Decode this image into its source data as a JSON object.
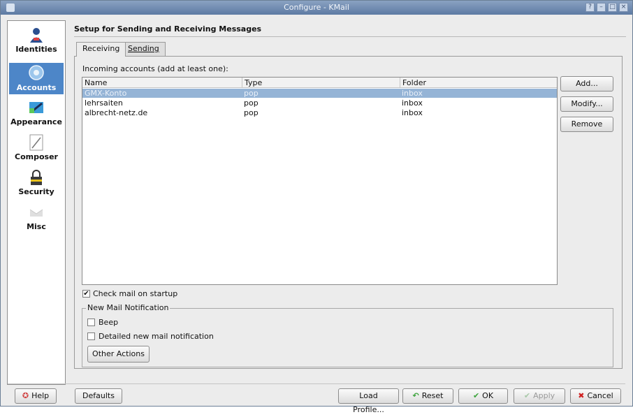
{
  "window": {
    "title": "Configure - KMail"
  },
  "sidebar": {
    "items": [
      {
        "label": "Identities",
        "icon": "identities-icon"
      },
      {
        "label": "Accounts",
        "icon": "accounts-icon"
      },
      {
        "label": "Appearance",
        "icon": "appearance-icon"
      },
      {
        "label": "Composer",
        "icon": "composer-icon"
      },
      {
        "label": "Security",
        "icon": "security-icon"
      },
      {
        "label": "Misc",
        "icon": "misc-icon"
      }
    ],
    "selected": "Accounts"
  },
  "header": {
    "title": "Setup for Sending and Receiving Messages"
  },
  "tabs": [
    {
      "label": "Receiving",
      "active": true
    },
    {
      "label": "Sending",
      "active": false
    }
  ],
  "receiving": {
    "accounts_label": "Incoming accounts (add at least one):",
    "columns": [
      "Name",
      "Type",
      "Folder"
    ],
    "rows": [
      {
        "name": "GMX-Konto",
        "type": "pop",
        "folder": "inbox",
        "selected": true
      },
      {
        "name": "lehrsaiten",
        "type": "pop",
        "folder": "inbox",
        "selected": false
      },
      {
        "name": "albrecht-netz.de",
        "type": "pop",
        "folder": "inbox",
        "selected": false
      }
    ],
    "buttons": {
      "add": "Add...",
      "modify": "Modify...",
      "remove": "Remove"
    },
    "check_on_startup": {
      "label": "Check mail on startup",
      "checked": true
    },
    "notification": {
      "title": "New Mail Notification",
      "beep": {
        "label": "Beep",
        "checked": false
      },
      "detailed": {
        "label": "Detailed new mail notification",
        "checked": false
      },
      "other_actions": "Other Actions"
    }
  },
  "footer": {
    "help": "Help",
    "defaults": "Defaults",
    "load_profile": "Load Profile...",
    "reset": "Reset",
    "ok": "OK",
    "apply": "Apply",
    "cancel": "Cancel"
  },
  "colors": {
    "selection": "#4d86c8",
    "row_selected": "#95b4d6",
    "titlebar": "#6f8bb2"
  }
}
